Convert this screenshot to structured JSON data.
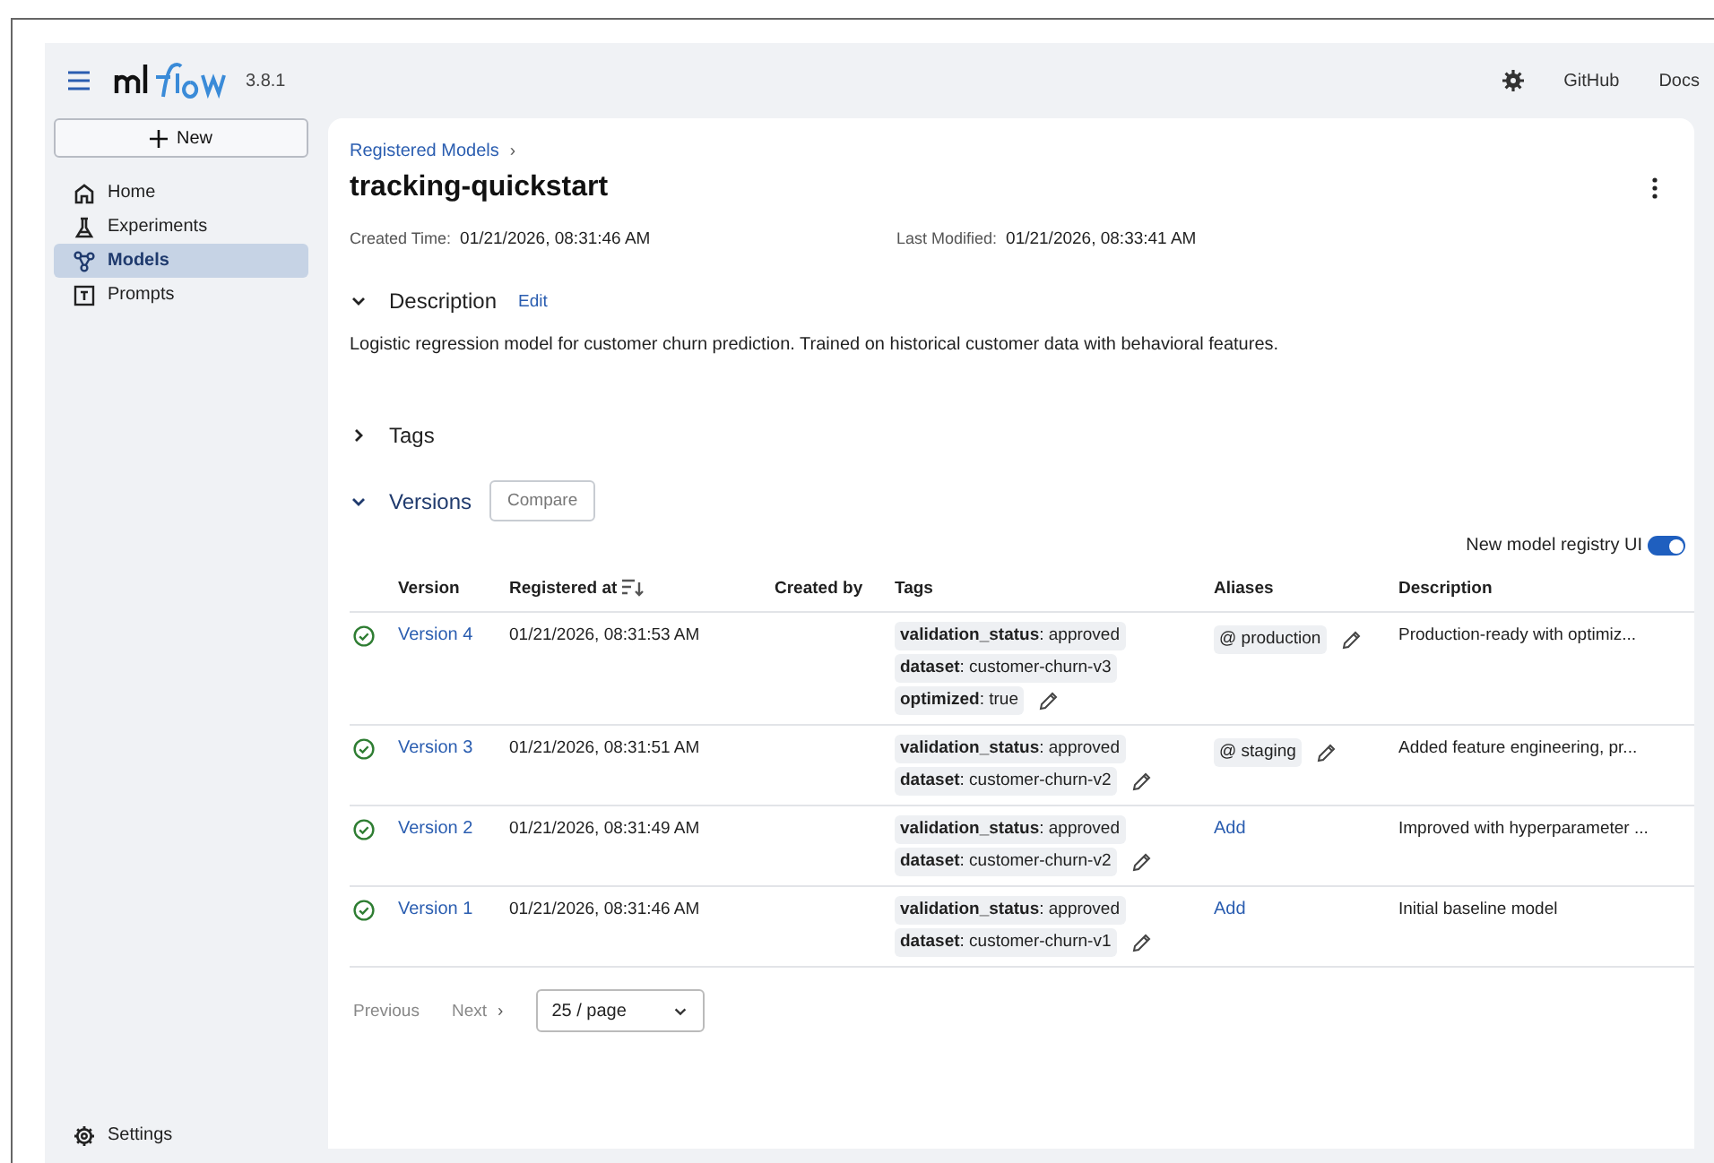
{
  "header": {
    "version": "3.8.1",
    "links": [
      "GitHub",
      "Docs"
    ]
  },
  "sidebar": {
    "new_button": "New",
    "items": [
      {
        "label": "Home",
        "kind": "home",
        "selected": false
      },
      {
        "label": "Experiments",
        "kind": "experiments",
        "selected": false
      },
      {
        "label": "Models",
        "kind": "models",
        "selected": true
      },
      {
        "label": "Prompts",
        "kind": "prompts",
        "selected": false
      }
    ],
    "settings": "Settings"
  },
  "breadcrumb": "Registered Models",
  "breadcrumb_sep": "›",
  "title": "tracking-quickstart",
  "meta": [
    {
      "label": "Created Time:",
      "value": "01/21/2026, 08:31:46 AM"
    },
    {
      "label": "Last Modified:",
      "value": "01/21/2026, 08:33:41 AM"
    }
  ],
  "description": {
    "title": "Description",
    "expanded": true,
    "edit": "Edit",
    "text": "Logistic regression model for customer churn prediction. Trained on historical customer data with behavioral features."
  },
  "tags_section": {
    "title": "Tags",
    "expanded": false
  },
  "versions": {
    "title": "Versions",
    "expanded": true,
    "compare": "Compare",
    "toggle": {
      "label": "New model registry UI",
      "on": true
    },
    "columns": [
      "Version",
      "Registered at",
      "Created by",
      "Tags",
      "Aliases",
      "Description"
    ],
    "rows": [
      {
        "version": "Version 4",
        "registered": "01/21/2026, 08:31:53 AM",
        "tags": [
          "**validation_status**: approved",
          "**dataset**: customer-churn-v3",
          "**optimized**: true"
        ],
        "aliases": [
          "@ production"
        ],
        "description": "Production-ready with optimiz..."
      },
      {
        "version": "Version 3",
        "registered": "01/21/2026, 08:31:51 AM",
        "tags": [
          "**validation_status**: approved",
          "**dataset**: customer-churn-v2"
        ],
        "aliases": [
          "@ staging"
        ],
        "description": "Added feature engineering, pr..."
      },
      {
        "version": "Version 2",
        "registered": "01/21/2026, 08:31:49 AM",
        "tags": [
          "**validation_status**: approved",
          "**dataset**: customer-churn-v2"
        ],
        "aliases": [],
        "add_alias": "Add",
        "description": "Improved with hyperparameter ..."
      },
      {
        "version": "Version 1",
        "registered": "01/21/2026, 08:31:46 AM",
        "tags": [
          "**validation_status**: approved",
          "**dataset**: customer-churn-v1"
        ],
        "aliases": [],
        "add_alias": "Add",
        "description": "Initial baseline model"
      }
    ]
  },
  "pagination": {
    "previous": "Previous",
    "next": "Next",
    "next_arrow": "›",
    "page_size": "25 / page"
  }
}
